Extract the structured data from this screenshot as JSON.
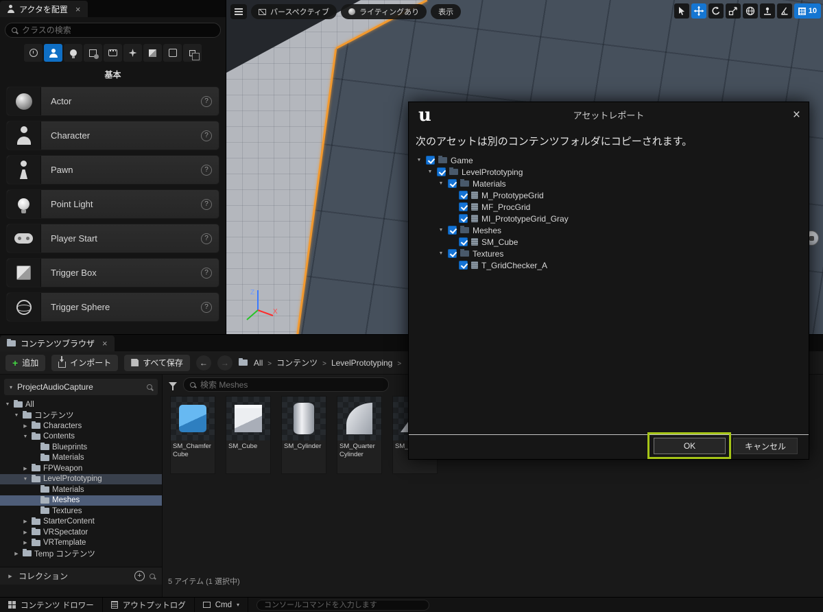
{
  "icons": {
    "help_glyph": "?",
    "close_glyph": "×",
    "logo_glyph": "u",
    "caret_glyph": "▾",
    "back_glyph": "←",
    "forward_glyph": "→"
  },
  "place_actors": {
    "tab": "アクタを配置",
    "search_placeholder": "クラスの検索",
    "section": "基本",
    "items": [
      {
        "label": "Actor",
        "icon": "sphere"
      },
      {
        "label": "Character",
        "icon": "character"
      },
      {
        "label": "Pawn",
        "icon": "pawn"
      },
      {
        "label": "Point Light",
        "icon": "bulb"
      },
      {
        "label": "Player Start",
        "icon": "gamepad"
      },
      {
        "label": "Trigger Box",
        "icon": "box"
      },
      {
        "label": "Trigger Sphere",
        "icon": "spherewire"
      }
    ]
  },
  "viewport": {
    "menu_buttons": [
      {
        "label": "パースペクティブ"
      },
      {
        "label": "ライティングあり"
      },
      {
        "label": "表示"
      }
    ],
    "grid_snap_value": "10",
    "axis": {
      "z": "Z",
      "x": "X"
    }
  },
  "dialog": {
    "title": "アセットレポート",
    "message": "次のアセットは別のコンテンツフォルダにコピーされます。",
    "tree": [
      {
        "label": "Game",
        "depth": 0,
        "arrow": "open",
        "icon": "folder"
      },
      {
        "label": "LevelPrototyping",
        "depth": 1,
        "arrow": "open",
        "icon": "folder"
      },
      {
        "label": "Materials",
        "depth": 2,
        "arrow": "open",
        "icon": "folder"
      },
      {
        "label": "M_PrototypeGrid",
        "depth": 3,
        "arrow": "none",
        "icon": "asset"
      },
      {
        "label": "MF_ProcGrid",
        "depth": 3,
        "arrow": "none",
        "icon": "asset"
      },
      {
        "label": "MI_PrototypeGrid_Gray",
        "depth": 3,
        "arrow": "none",
        "icon": "asset"
      },
      {
        "label": "Meshes",
        "depth": 2,
        "arrow": "open",
        "icon": "folder"
      },
      {
        "label": "SM_Cube",
        "depth": 3,
        "arrow": "none",
        "icon": "asset"
      },
      {
        "label": "Textures",
        "depth": 2,
        "arrow": "open",
        "icon": "folder"
      },
      {
        "label": "T_GridChecker_A",
        "depth": 3,
        "arrow": "none",
        "icon": "asset"
      }
    ],
    "ok_label": "OK",
    "cancel_label": "キャンセル"
  },
  "content_browser": {
    "tab": "コンテンツブラウザ",
    "add_label": "追加",
    "import_label": "インポート",
    "save_all_label": "すべて保存",
    "breadcrumbs": [
      {
        "label": "All"
      },
      {
        "label": "コンテンツ"
      },
      {
        "label": "LevelPrototyping"
      }
    ],
    "source_title": "ProjectAudioCapture",
    "tree": [
      {
        "label": "All",
        "depth": 0,
        "arrow": "open",
        "state": "plain"
      },
      {
        "label": "コンテンツ",
        "depth": 1,
        "arrow": "open",
        "state": "plain"
      },
      {
        "label": "Characters",
        "depth": 2,
        "arrow": "closed",
        "state": "plain"
      },
      {
        "label": "Contents",
        "depth": 2,
        "arrow": "open",
        "state": "plain"
      },
      {
        "label": "Blueprints",
        "depth": 3,
        "arrow": "none",
        "state": "plain"
      },
      {
        "label": "Materials",
        "depth": 3,
        "arrow": "none",
        "state": "plain"
      },
      {
        "label": "FPWeapon",
        "depth": 2,
        "arrow": "closed",
        "state": "plain"
      },
      {
        "label": "LevelPrototyping",
        "depth": 2,
        "arrow": "open",
        "state": "hl"
      },
      {
        "label": "Materials",
        "depth": 3,
        "arrow": "none",
        "state": "plain"
      },
      {
        "label": "Meshes",
        "depth": 3,
        "arrow": "none",
        "state": "sel"
      },
      {
        "label": "Textures",
        "depth": 3,
        "arrow": "none",
        "state": "plain"
      },
      {
        "label": "StarterContent",
        "depth": 2,
        "arrow": "closed",
        "state": "plain"
      },
      {
        "label": "VRSpectator",
        "depth": 2,
        "arrow": "closed",
        "state": "plain"
      },
      {
        "label": "VRTemplate",
        "depth": 2,
        "arrow": "closed",
        "state": "plain"
      },
      {
        "label": "Temp コンテンツ",
        "depth": 1,
        "arrow": "closed",
        "state": "plain"
      }
    ],
    "collections_label": "コレクション",
    "search_placeholder": "検索 Meshes",
    "assets": [
      {
        "name": "SM_Chamfer Cube",
        "variant": "chamfer",
        "state": "plain"
      },
      {
        "name": "SM_Cube",
        "variant": "cube",
        "state": "sel"
      },
      {
        "name": "SM_Cylinder",
        "variant": "cylinder",
        "state": "plain"
      },
      {
        "name": "SM_Quarter Cylinder",
        "variant": "quarter",
        "state": "plain"
      },
      {
        "name": "SM_Ramp",
        "variant": "ramp",
        "state": "plain"
      }
    ],
    "status": "5 アイテム (1 選択中)"
  },
  "bottom_bar": {
    "content_drawer": "コンテンツ ドロワー",
    "output_log": "アウトプットログ",
    "cmd": "Cmd",
    "console_placeholder": "コンソールコマンドを入力します"
  }
}
